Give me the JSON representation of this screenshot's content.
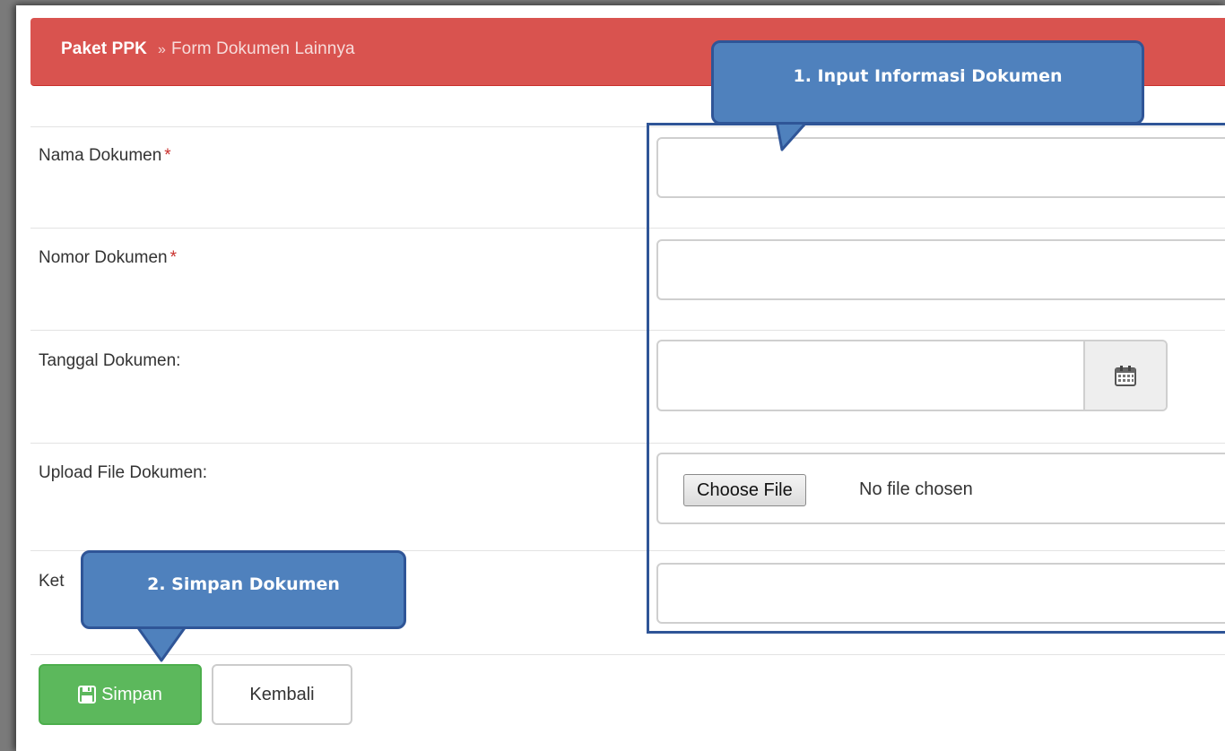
{
  "breadcrumb": {
    "root": "Paket PPK",
    "separator": "»",
    "current": "Form Dokumen Lainnya"
  },
  "form": {
    "fields": [
      {
        "label": "Nama Dokumen",
        "required": "*",
        "value": ""
      },
      {
        "label": "Nomor Dokumen",
        "required": "*",
        "value": ""
      },
      {
        "label": "Tanggal Dokumen:",
        "value": ""
      },
      {
        "label": "Upload File Dokumen:",
        "file_button": "Choose File",
        "file_status": "No file chosen"
      },
      {
        "label": "Ket",
        "value": ""
      }
    ]
  },
  "actions": {
    "save_label": "Simpan",
    "back_label": "Kembali"
  },
  "callouts": {
    "first": "1.   Input Informasi Dokumen",
    "second": "2. Simpan Dokumen"
  },
  "icons": {
    "calendar": "calendar-icon",
    "save": "floppy-disk-icon"
  },
  "colors": {
    "header": "#d9534f",
    "save_button": "#5cb85c",
    "callout_fill": "#4f81bd",
    "callout_border": "#2f5597"
  }
}
